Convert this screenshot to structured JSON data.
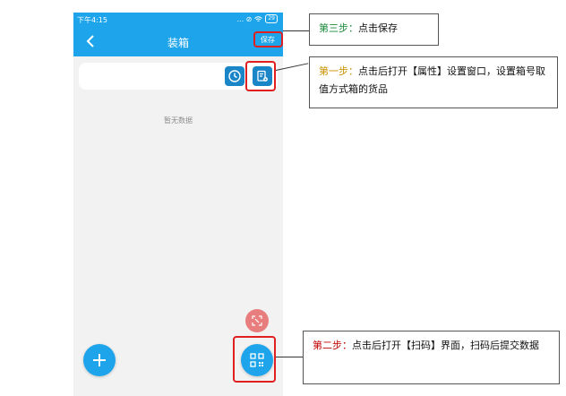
{
  "status_bar": {
    "time": "下午4:15",
    "icons_text": "... ⊘",
    "battery": "29"
  },
  "navbar": {
    "title": "装箱",
    "save_label": "保存"
  },
  "list": {
    "empty_text": "暂无数据"
  },
  "icons": {
    "back": "chevron-left-icon",
    "history": "clock-icon",
    "properties": "document-settings-icon",
    "scan_small": "scan-corners-icon",
    "add": "plus-icon",
    "scan": "qr-code-icon"
  },
  "colors": {
    "primary": "#1ea4ea",
    "icon_button": "#1a86c8",
    "fab_secondary": "#e87d7d",
    "highlight": "#e02020",
    "step1": "#c89000",
    "step2": "#c00000",
    "step3": "#1a8a3a"
  },
  "callouts": {
    "step3": {
      "label": "第三步：",
      "text": "点击保存"
    },
    "step1": {
      "label": "第一步：",
      "text": "点击后打开【属性】设置窗口，设置箱号取值方式箱的货品"
    },
    "step2": {
      "label": "第二步：",
      "text": "点击后打开【扫码】界面，扫码后提交数据"
    }
  }
}
